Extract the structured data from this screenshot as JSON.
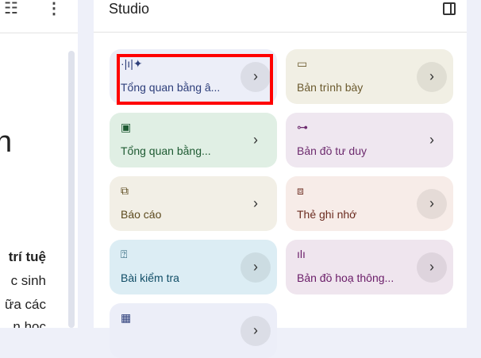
{
  "left_panel": {
    "partial_heading": "n",
    "partial_lines": [
      "trí tuệ",
      "c sinh",
      "ữa các",
      "n học"
    ]
  },
  "studio": {
    "title": "Studio",
    "cards": [
      {
        "label": "Tổng quan bằng â...",
        "icon": "audio-wave-icon",
        "bg": "#eceef8",
        "fg": "#2d3e7a"
      },
      {
        "label": "Bản trình bày",
        "icon": "slides-icon",
        "bg": "#f1efe4",
        "fg": "#6b5a2e"
      },
      {
        "label": "Tổng quan bằng...",
        "icon": "video-icon",
        "bg": "#e0efe4",
        "fg": "#1e5a32"
      },
      {
        "label": "Bản đồ tư duy",
        "icon": "mind-map-icon",
        "bg": "#efe7f0",
        "fg": "#6d2b6e"
      },
      {
        "label": "Báo cáo",
        "icon": "report-icon",
        "bg": "#f2efe6",
        "fg": "#5c4a1e"
      },
      {
        "label": "Thẻ ghi nhớ",
        "icon": "flashcards-icon",
        "bg": "#f7ece8",
        "fg": "#6b2b1f"
      },
      {
        "label": "Bài kiểm tra",
        "icon": "quiz-icon",
        "bg": "#dcedf4",
        "fg": "#104d66"
      },
      {
        "label": "Bản đồ hoạ thông...",
        "icon": "infographic-icon",
        "bg": "#efe5ee",
        "fg": "#6a1c68"
      },
      {
        "label": "",
        "icon": "table-icon",
        "bg": "#eceef8",
        "fg": "#2d3e7a"
      }
    ]
  }
}
